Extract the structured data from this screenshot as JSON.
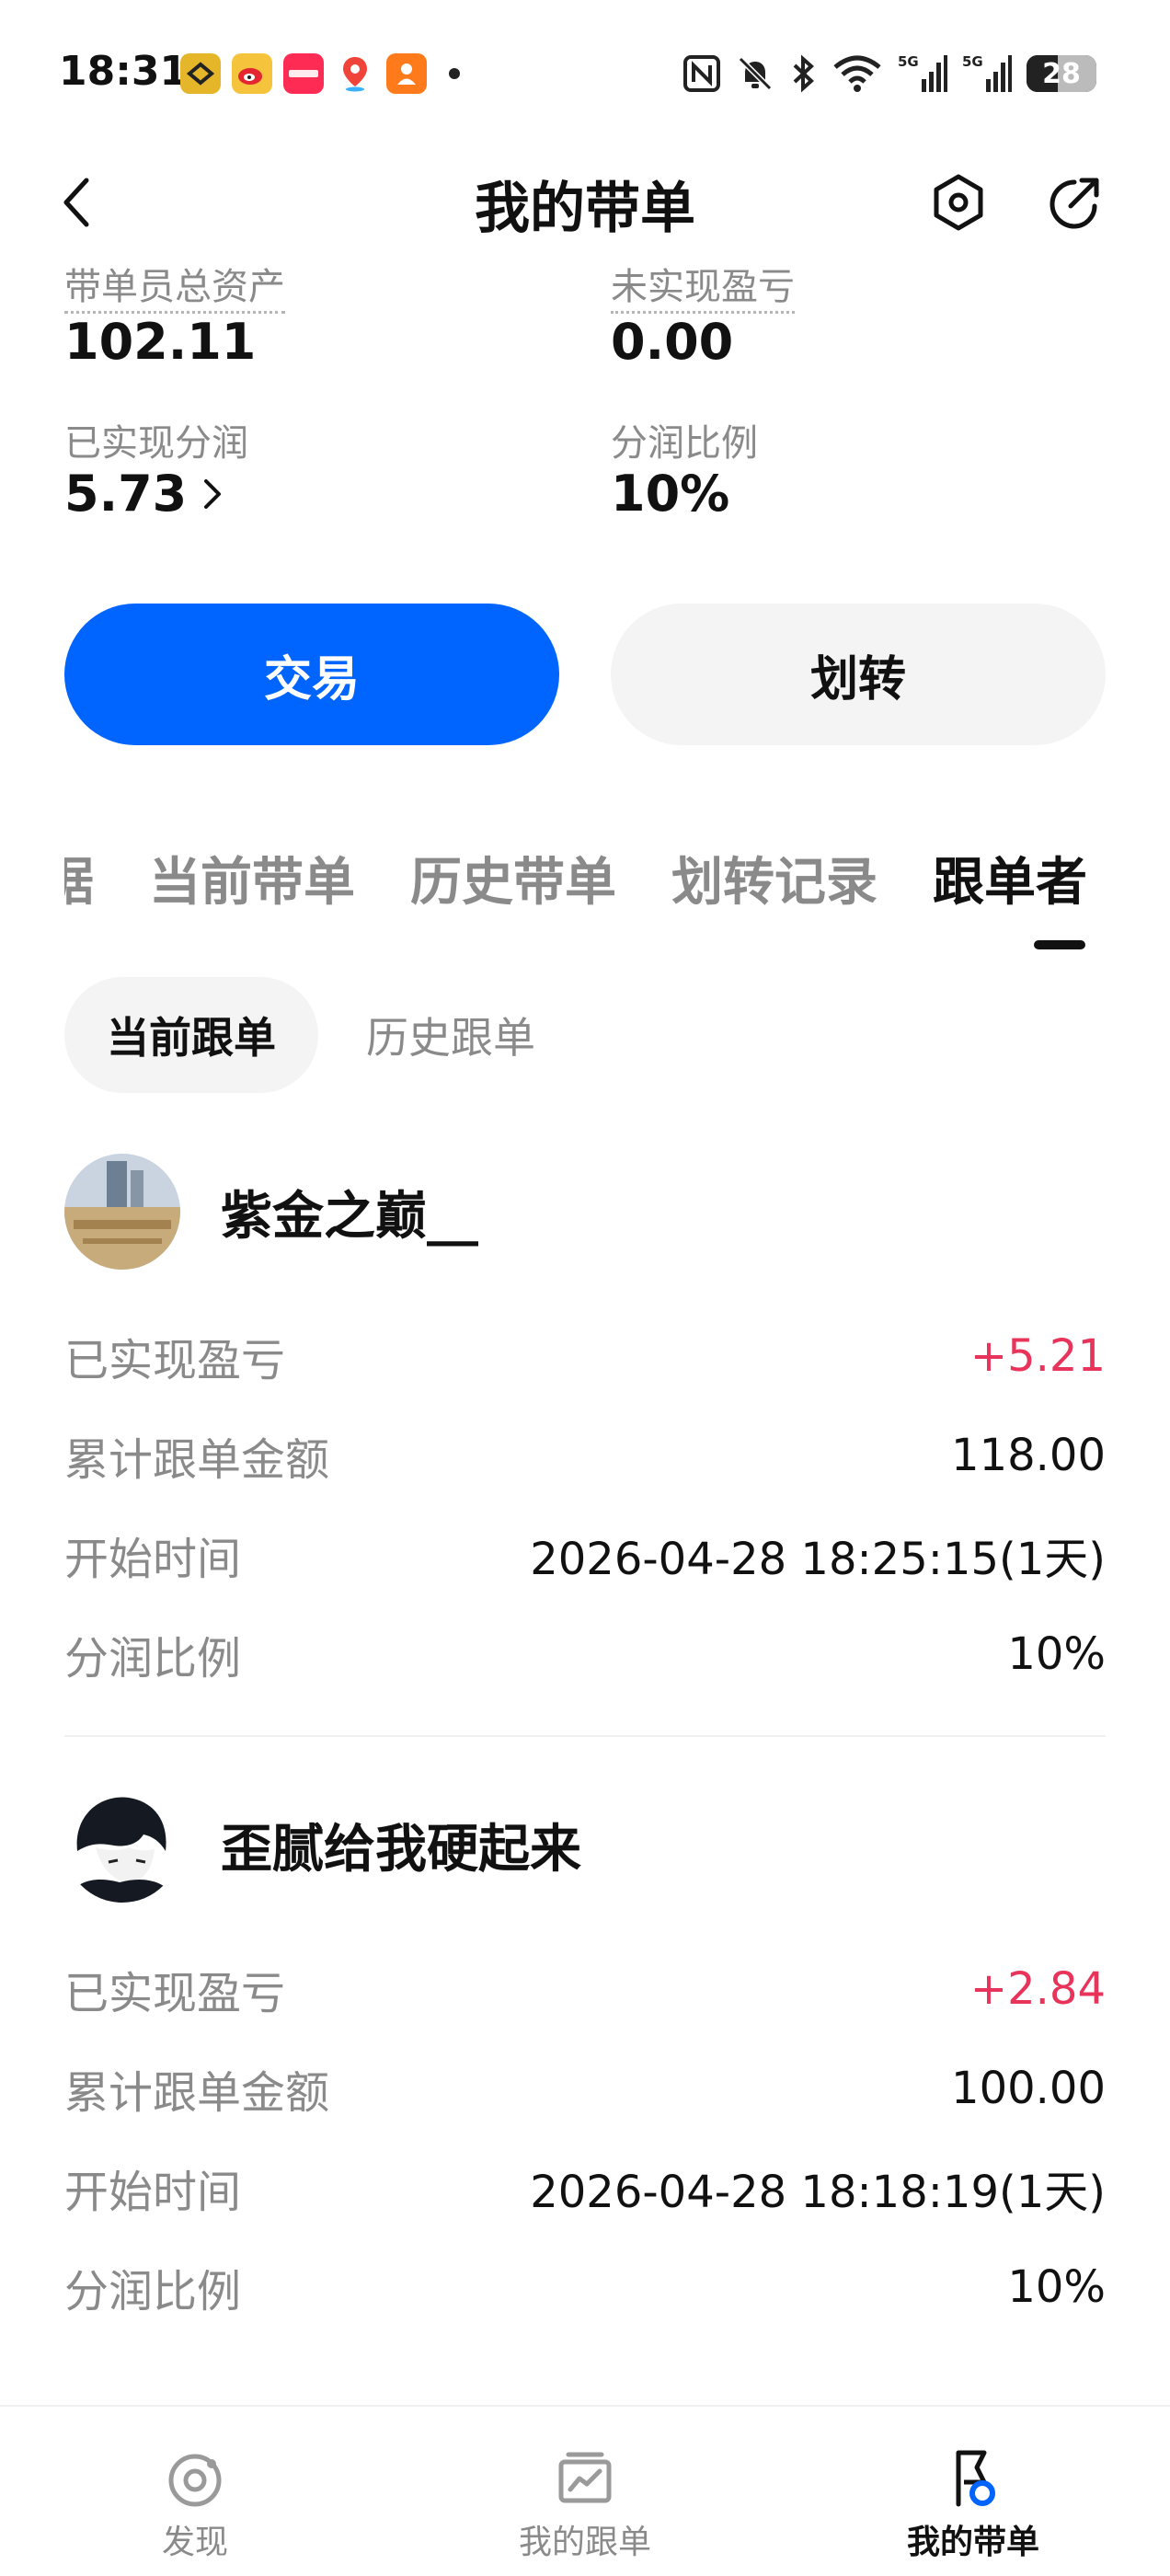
{
  "status_bar": {
    "time": "18:31",
    "battery": "28",
    "app_icons": [
      "wallet-app-icon",
      "weibo-icon",
      "xiaohongshu-icon",
      "maps-icon",
      "delivery-app-icon"
    ],
    "system_icons": [
      "nfc-icon",
      "mute-icon",
      "bluetooth-icon",
      "wifi-icon",
      "signal-5g-1-icon",
      "signal-5g-2-icon"
    ]
  },
  "header": {
    "title": "我的带单",
    "back_icon": "chevron-left-icon",
    "settings_icon": "settings-hexagon-icon",
    "share_icon": "share-arrow-icon"
  },
  "stats": {
    "total_assets_label": "带单员总资产",
    "total_assets_value": "102.11",
    "unrealized_label": "未实现盈亏",
    "unrealized_value": "0.00",
    "realized_share_label": "已实现分润",
    "realized_share_value": "5.73",
    "share_ratio_label": "分润比例",
    "share_ratio_value": "10%"
  },
  "actions": {
    "trade_label": "交易",
    "transfer_label": "划转"
  },
  "tabs": {
    "items": [
      "数据",
      "当前带单",
      "历史带单",
      "划转记录",
      "跟单者"
    ],
    "active": "跟单者"
  },
  "subtabs": {
    "current": "当前跟单",
    "history": "历史跟单"
  },
  "followers": [
    {
      "name": "紫金之巅__",
      "realized_pnl_label": "已实现盈亏",
      "realized_pnl": "+5.21",
      "total_amount_label": "累计跟单金额",
      "total_amount": "118.00",
      "start_time_label": "开始时间",
      "start_time": "2026-04-28 18:25:15(1天)",
      "share_ratio_label": "分润比例",
      "share_ratio": "10%"
    },
    {
      "name": "歪腻给我硬起来",
      "realized_pnl_label": "已实现盈亏",
      "realized_pnl": "+2.84",
      "total_amount_label": "累计跟单金额",
      "total_amount": "100.00",
      "start_time_label": "开始时间",
      "start_time": "2026-04-28 18:18:19(1天)",
      "share_ratio_label": "分润比例",
      "share_ratio": "10%"
    }
  ],
  "bottom_nav": {
    "discover": "发现",
    "my_follow": "我的跟单",
    "my_lead": "我的带单",
    "active": "我的带单"
  },
  "colors": {
    "accent": "#0064ff",
    "positive": "#e8345a",
    "muted_text": "#8a8a8a"
  }
}
